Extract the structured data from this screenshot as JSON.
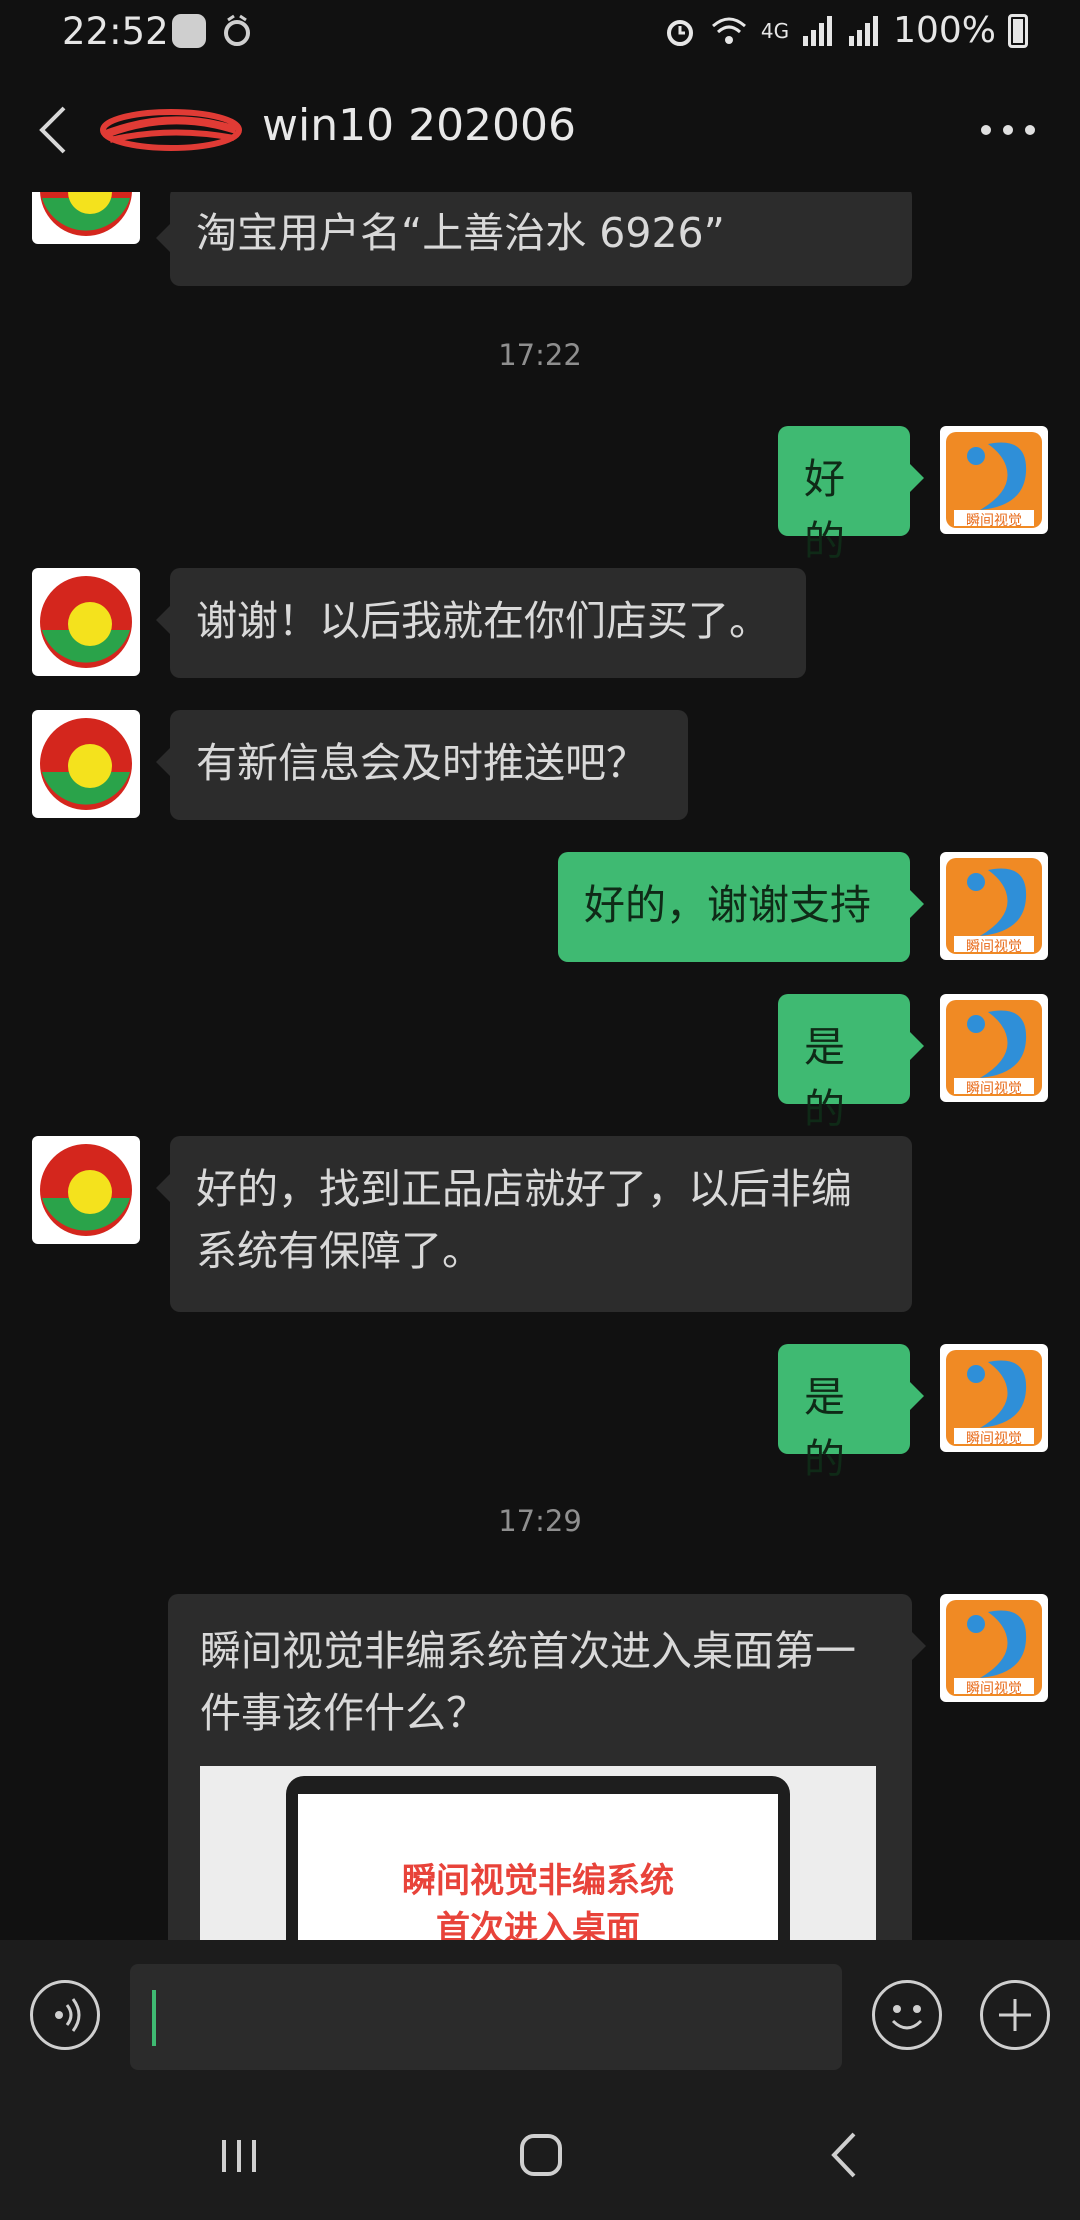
{
  "status_bar": {
    "time": "22:52",
    "network": "4G",
    "battery": "100%"
  },
  "header": {
    "title": "win10 202006",
    "back_icon": "chevron-left-icon",
    "more_icon": "more-horizontal-icon"
  },
  "messages": [
    {
      "type": "in",
      "text": "淘宝用户名“上善治水 6926”"
    },
    {
      "type": "time",
      "text": "17:22"
    },
    {
      "type": "out",
      "text": "好的"
    },
    {
      "type": "in",
      "text": "谢谢！以后我就在你们店买了。"
    },
    {
      "type": "in",
      "text": "有新信息会及时推送吧？"
    },
    {
      "type": "out",
      "text": "好的，谢谢支持"
    },
    {
      "type": "out",
      "text": "是的"
    },
    {
      "type": "in",
      "text": "好的，找到正品店就好了，以后非编\n系统有保障了。"
    },
    {
      "type": "out",
      "text": "是的"
    },
    {
      "type": "time",
      "text": "17:29"
    }
  ],
  "card": {
    "title": "瞬间视觉非编系统首次进入桌面第一件事该作什么？",
    "thumbnail_text_1": "瞬间视觉非编系统",
    "thumbnail_text_2": "首次进入桌面"
  },
  "avatar_label": "瞬间视觉",
  "input": {
    "value": ""
  },
  "colors": {
    "background": "#111111",
    "incoming_bubble": "#2c2c2c",
    "outgoing_bubble": "#3fba72",
    "accent": "#3fba72"
  },
  "icons": {
    "voice": "voice-icon",
    "emoji": "emoji-icon",
    "add": "plus-icon",
    "nav_recents": "recents-icon",
    "nav_home": "home-icon",
    "nav_back": "back-icon"
  }
}
